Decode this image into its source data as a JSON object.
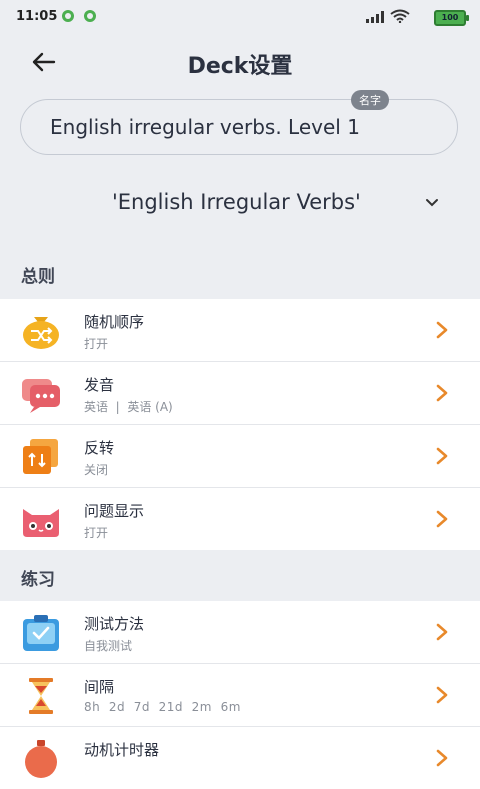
{
  "status": {
    "time": "11:05",
    "battery": "100"
  },
  "header": {
    "title": "Deck设置"
  },
  "name_field": {
    "value": "English irregular verbs. Level 1",
    "badge": "名字"
  },
  "deck_select": {
    "value": "'English Irregular Verbs'"
  },
  "sections": {
    "general": {
      "title": "总则",
      "items": [
        {
          "title": "随机顺序",
          "subtitle": "打开",
          "icon": "shuffle-icon"
        },
        {
          "title": "发音",
          "subtitle_a": "英语",
          "subtitle_sep": "|",
          "subtitle_b": "英语 (A)",
          "icon": "speech-icon"
        },
        {
          "title": "反转",
          "subtitle": "关闭",
          "icon": "reverse-icon"
        },
        {
          "title": "问题显示",
          "subtitle": "打开",
          "icon": "cat-face-icon"
        }
      ]
    },
    "practice": {
      "title": "练习",
      "items": [
        {
          "title": "测试方法",
          "subtitle": "自我测试",
          "icon": "clipboard-icon"
        },
        {
          "title": "间隔",
          "subtitle": "8h  2d  7d  21d  2m  6m",
          "icon": "hourglass-icon"
        },
        {
          "title": "动机计时器",
          "icon": "timer-icon"
        }
      ]
    }
  },
  "colors": {
    "accent": "#e8892b",
    "background": "#eceef2"
  }
}
